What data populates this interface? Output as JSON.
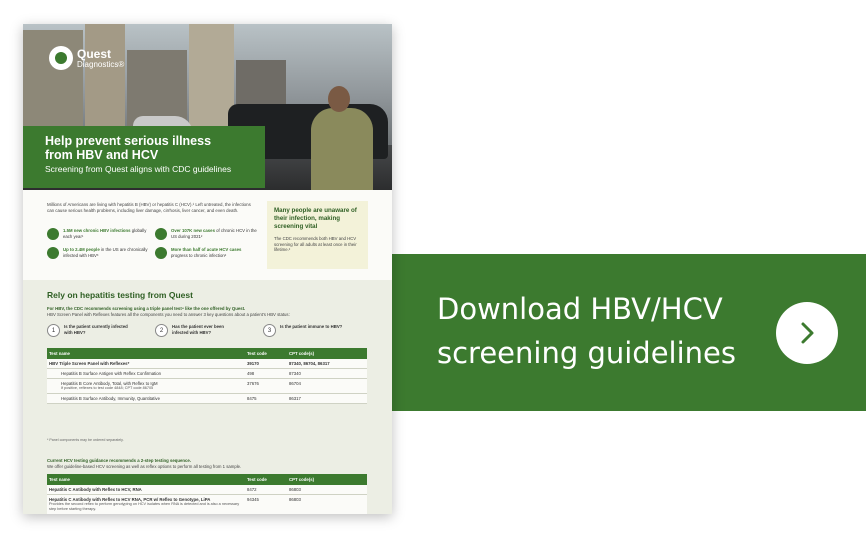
{
  "cta": {
    "line1": "Download HBV/HCV",
    "line2": "screening guidelines",
    "button_icon": "chevron-right-icon",
    "color": "#3c7a2f"
  },
  "doc": {
    "logo": {
      "name": "Quest",
      "sub": "Diagnostics®"
    },
    "title_line1": "Help prevent serious illness",
    "title_line2": "from HBV and HCV",
    "subtitle": "Screening from Quest aligns with CDC guidelines",
    "intro": "Millions of Americans are living with hepatitis B (HBV) or hepatitis C (HCV).¹ Left untreated, the infections can cause serious health problems, including liver damage, cirrhosis, liver cancer, and even death.",
    "stats": [
      {
        "icon": "globe-icon",
        "bold": "1.5M new chronic HBV infections",
        "text": " globally each year¹"
      },
      {
        "icon": "chart-icon",
        "bold": "Over 107K new cases",
        "text": " of chronic HCV in the US during 2021²"
      },
      {
        "icon": "map-icon",
        "bold": "Up to 2.4M people",
        "text": " in the US are chronically infected with HBV³"
      },
      {
        "icon": "people-icon",
        "bold": "More than half of acute HCV cases",
        "text": " progress to chronic infection²"
      }
    ],
    "callout": {
      "title": "Many people are unaware of their infection, making screening vital",
      "body": "The CDC recommends both HBV and HCV screening for all adults at least once in their lifetime.²"
    },
    "rely_title": "Rely on hepatitis testing from Quest",
    "rely_intro_bold": "For HBV, the CDC recommends screening using a triple panel test⁴ like the one offered by Quest.",
    "rely_intro": "HBV Screen Panel with Reflexes features all the components you need to answer 3 key questions about a patient's HBV status:",
    "steps": [
      {
        "num": "1",
        "text": "Is the patient currently infected with HBV?"
      },
      {
        "num": "2",
        "text": "Has the patient ever been infected with HBV?"
      },
      {
        "num": "3",
        "text": "Is the patient immune to HBV?"
      }
    ],
    "table_headers": {
      "name": "Test name",
      "code": "Test code",
      "cpt": "CPT code(s)"
    },
    "hbv_rows": [
      {
        "name": "HBV Triple Screen Panel with Reflexes*",
        "code": "39170",
        "cpt": "87340, 86704, 86317",
        "note": ""
      },
      {
        "name": "Hepatitis B Surface Antigen with Reflex Confirmation",
        "code": "498",
        "cpt": "87340",
        "note": ""
      },
      {
        "name": "Hepatitis B Core Antibody, Total, with Reflex to IgM",
        "code": "37676",
        "cpt": "86704",
        "note": "If positive, reflexes to test code 4848; CPT code 86705"
      },
      {
        "name": "Hepatitis B Surface Antibody, Immunity, Quantitative",
        "code": "8475",
        "cpt": "86317",
        "note": ""
      }
    ],
    "table_footnote": "* Panel components may be ordered separately.",
    "hcv_intro_bold": "Current HCV testing guidance recommends a 2-step testing sequence.",
    "hcv_intro": "We offer guideline-based HCV screening as well as reflex options to perform all testing from 1 sample.",
    "hcv_rows": [
      {
        "name": "Hepatitis C Antibody with Reflex to HCV, RNA",
        "code": "8472",
        "cpt": "86803",
        "note": ""
      },
      {
        "name": "Hepatitis C Antibody with Reflex to HCV RNA, PCR w/ Reflex to Genotype, LiPA",
        "code": "94345",
        "cpt": "86803",
        "note": "Provides the second reflex to perform genotyping on HCV isolates when RNA is detected and is also a necessary step before starting therapy."
      }
    ]
  }
}
